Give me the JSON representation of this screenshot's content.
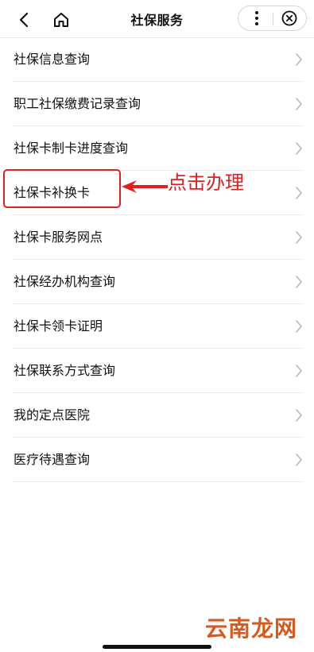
{
  "navbar": {
    "title": "社保服务",
    "back_icon": "chevron-left-icon",
    "home_icon": "home-icon",
    "more_icon": "more-vertical-icon",
    "close_icon": "close-circle-icon"
  },
  "menu": {
    "items": [
      {
        "label": "社保信息查询"
      },
      {
        "label": "职工社保缴费记录查询"
      },
      {
        "label": "社保卡制卡进度查询"
      },
      {
        "label": "社保卡补换卡"
      },
      {
        "label": "社保卡服务网点"
      },
      {
        "label": "社保经办机构查询"
      },
      {
        "label": "社保卡领卡证明"
      },
      {
        "label": "社保联系方式查询"
      },
      {
        "label": "我的定点医院"
      },
      {
        "label": "医疗待遇查询"
      }
    ]
  },
  "annotation": {
    "text": "点击办理",
    "color": "#e02020"
  },
  "watermark": {
    "text": "云南龙网",
    "color": "#d9581c"
  }
}
